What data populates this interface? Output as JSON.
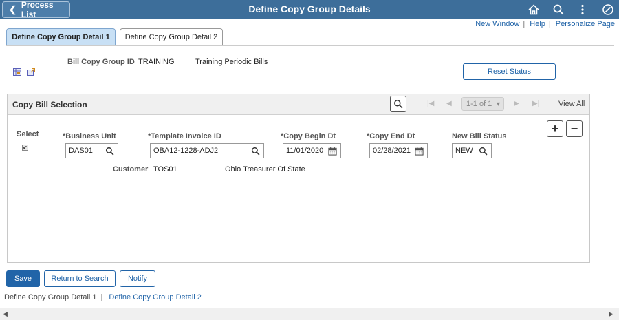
{
  "header": {
    "back_label": "Process List",
    "title": "Define Copy Group Details"
  },
  "links": {
    "new_window": "New Window",
    "help": "Help",
    "personalize": "Personalize Page",
    "separator": "|"
  },
  "tabs": [
    {
      "label": "Define Copy Group Detail 1",
      "active": true
    },
    {
      "label": "Define Copy Group Detail 2",
      "active": false
    }
  ],
  "form": {
    "bill_copy_group_label": "Bill Copy Group ID",
    "bill_copy_group_id": "TRAINING",
    "bill_copy_group_desc": "Training Periodic Bills",
    "reset_status": "Reset Status"
  },
  "grid": {
    "title": "Copy Bill Selection",
    "range": "1-1 of 1",
    "view_all": "View All",
    "sep": "|",
    "columns": {
      "select": "Select",
      "business_unit": "*Business Unit",
      "template_invoice": "*Template Invoice ID",
      "copy_begin": "*Copy Begin Dt",
      "copy_end": "*Copy End Dt",
      "new_bill_status": "New Bill Status"
    },
    "row": {
      "select_check": "✔",
      "business_unit": "DAS01",
      "template_invoice": "OBA12-1228-ADJ2",
      "copy_begin": "11/01/2020",
      "copy_end": "02/28/2021",
      "new_bill_status": "NEW",
      "customer_label": "Customer",
      "customer_id": "TOS01",
      "customer_name": "Ohio Treasurer Of State"
    },
    "add": "+",
    "remove": "−"
  },
  "buttons": {
    "save": "Save",
    "return": "Return to Search",
    "notify": "Notify"
  },
  "bottom_links": {
    "page1": "Define Copy Group Detail 1",
    "sep": "|",
    "page2": "Define Copy Group Detail 2"
  },
  "colors": {
    "header_bg": "#3d6e9a",
    "accent": "#2164a8",
    "active_tab": "#c8e0f5"
  }
}
